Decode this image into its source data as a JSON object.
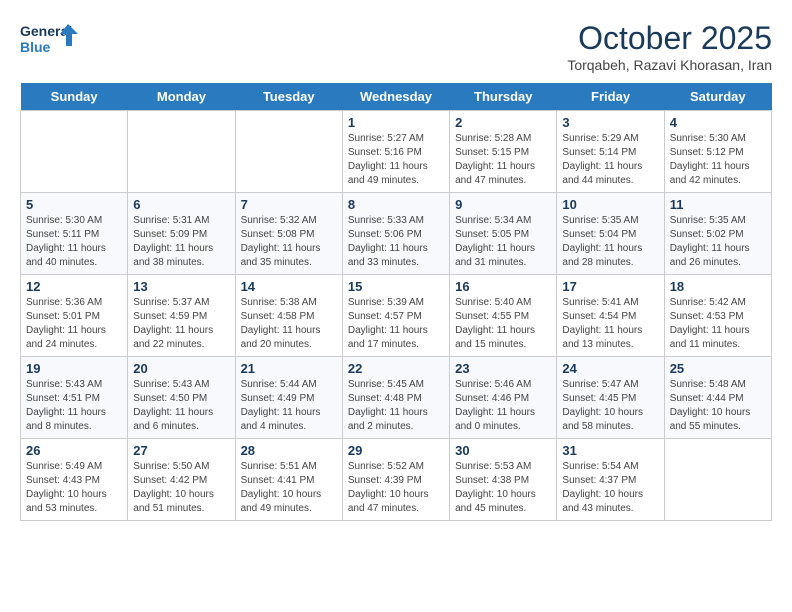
{
  "header": {
    "logo_line1": "General",
    "logo_line2": "Blue",
    "title": "October 2025",
    "subtitle": "Torqabeh, Razavi Khorasan, Iran"
  },
  "days_of_week": [
    "Sunday",
    "Monday",
    "Tuesday",
    "Wednesday",
    "Thursday",
    "Friday",
    "Saturday"
  ],
  "weeks": [
    [
      {
        "date": "",
        "info": ""
      },
      {
        "date": "",
        "info": ""
      },
      {
        "date": "",
        "info": ""
      },
      {
        "date": "1",
        "info": "Sunrise: 5:27 AM\nSunset: 5:16 PM\nDaylight: 11 hours\nand 49 minutes."
      },
      {
        "date": "2",
        "info": "Sunrise: 5:28 AM\nSunset: 5:15 PM\nDaylight: 11 hours\nand 47 minutes."
      },
      {
        "date": "3",
        "info": "Sunrise: 5:29 AM\nSunset: 5:14 PM\nDaylight: 11 hours\nand 44 minutes."
      },
      {
        "date": "4",
        "info": "Sunrise: 5:30 AM\nSunset: 5:12 PM\nDaylight: 11 hours\nand 42 minutes."
      }
    ],
    [
      {
        "date": "5",
        "info": "Sunrise: 5:30 AM\nSunset: 5:11 PM\nDaylight: 11 hours\nand 40 minutes."
      },
      {
        "date": "6",
        "info": "Sunrise: 5:31 AM\nSunset: 5:09 PM\nDaylight: 11 hours\nand 38 minutes."
      },
      {
        "date": "7",
        "info": "Sunrise: 5:32 AM\nSunset: 5:08 PM\nDaylight: 11 hours\nand 35 minutes."
      },
      {
        "date": "8",
        "info": "Sunrise: 5:33 AM\nSunset: 5:06 PM\nDaylight: 11 hours\nand 33 minutes."
      },
      {
        "date": "9",
        "info": "Sunrise: 5:34 AM\nSunset: 5:05 PM\nDaylight: 11 hours\nand 31 minutes."
      },
      {
        "date": "10",
        "info": "Sunrise: 5:35 AM\nSunset: 5:04 PM\nDaylight: 11 hours\nand 28 minutes."
      },
      {
        "date": "11",
        "info": "Sunrise: 5:35 AM\nSunset: 5:02 PM\nDaylight: 11 hours\nand 26 minutes."
      }
    ],
    [
      {
        "date": "12",
        "info": "Sunrise: 5:36 AM\nSunset: 5:01 PM\nDaylight: 11 hours\nand 24 minutes."
      },
      {
        "date": "13",
        "info": "Sunrise: 5:37 AM\nSunset: 4:59 PM\nDaylight: 11 hours\nand 22 minutes."
      },
      {
        "date": "14",
        "info": "Sunrise: 5:38 AM\nSunset: 4:58 PM\nDaylight: 11 hours\nand 20 minutes."
      },
      {
        "date": "15",
        "info": "Sunrise: 5:39 AM\nSunset: 4:57 PM\nDaylight: 11 hours\nand 17 minutes."
      },
      {
        "date": "16",
        "info": "Sunrise: 5:40 AM\nSunset: 4:55 PM\nDaylight: 11 hours\nand 15 minutes."
      },
      {
        "date": "17",
        "info": "Sunrise: 5:41 AM\nSunset: 4:54 PM\nDaylight: 11 hours\nand 13 minutes."
      },
      {
        "date": "18",
        "info": "Sunrise: 5:42 AM\nSunset: 4:53 PM\nDaylight: 11 hours\nand 11 minutes."
      }
    ],
    [
      {
        "date": "19",
        "info": "Sunrise: 5:43 AM\nSunset: 4:51 PM\nDaylight: 11 hours\nand 8 minutes."
      },
      {
        "date": "20",
        "info": "Sunrise: 5:43 AM\nSunset: 4:50 PM\nDaylight: 11 hours\nand 6 minutes."
      },
      {
        "date": "21",
        "info": "Sunrise: 5:44 AM\nSunset: 4:49 PM\nDaylight: 11 hours\nand 4 minutes."
      },
      {
        "date": "22",
        "info": "Sunrise: 5:45 AM\nSunset: 4:48 PM\nDaylight: 11 hours\nand 2 minutes."
      },
      {
        "date": "23",
        "info": "Sunrise: 5:46 AM\nSunset: 4:46 PM\nDaylight: 11 hours\nand 0 minutes."
      },
      {
        "date": "24",
        "info": "Sunrise: 5:47 AM\nSunset: 4:45 PM\nDaylight: 10 hours\nand 58 minutes."
      },
      {
        "date": "25",
        "info": "Sunrise: 5:48 AM\nSunset: 4:44 PM\nDaylight: 10 hours\nand 55 minutes."
      }
    ],
    [
      {
        "date": "26",
        "info": "Sunrise: 5:49 AM\nSunset: 4:43 PM\nDaylight: 10 hours\nand 53 minutes."
      },
      {
        "date": "27",
        "info": "Sunrise: 5:50 AM\nSunset: 4:42 PM\nDaylight: 10 hours\nand 51 minutes."
      },
      {
        "date": "28",
        "info": "Sunrise: 5:51 AM\nSunset: 4:41 PM\nDaylight: 10 hours\nand 49 minutes."
      },
      {
        "date": "29",
        "info": "Sunrise: 5:52 AM\nSunset: 4:39 PM\nDaylight: 10 hours\nand 47 minutes."
      },
      {
        "date": "30",
        "info": "Sunrise: 5:53 AM\nSunset: 4:38 PM\nDaylight: 10 hours\nand 45 minutes."
      },
      {
        "date": "31",
        "info": "Sunrise: 5:54 AM\nSunset: 4:37 PM\nDaylight: 10 hours\nand 43 minutes."
      },
      {
        "date": "",
        "info": ""
      }
    ]
  ]
}
